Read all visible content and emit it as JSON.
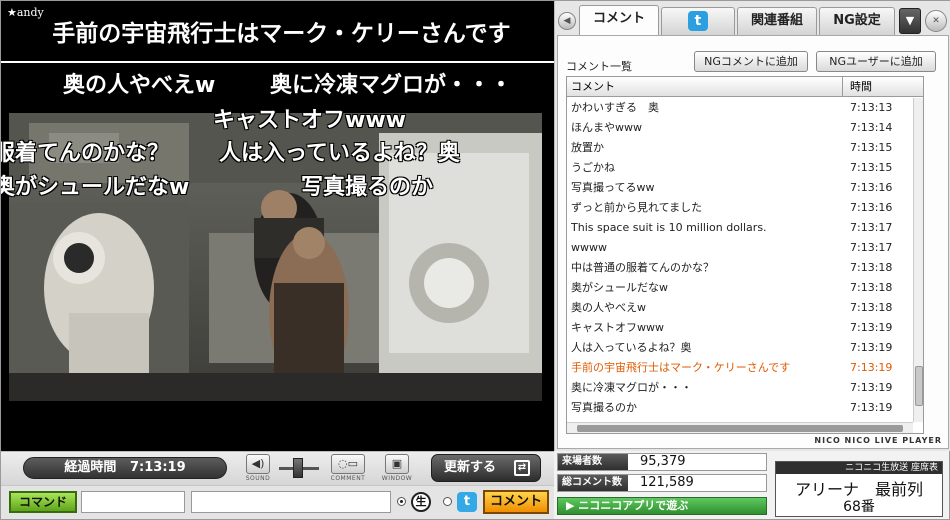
{
  "player": {
    "broadcaster": "andy",
    "telop": "手前の宇宙飛行士はマーク・ケリーさんです",
    "overlay_comments": [
      "奥の人やべえw",
      "奥に冷凍マグロが・・・",
      "キャストオフwww",
      "服着てんのかな？",
      "人は入っているよね？奥",
      "奥がシュールだなw",
      "写真撮るのか"
    ]
  },
  "controls": {
    "elapsed_label": "経過時間",
    "elapsed_time": "7:13:19",
    "sound_label": "SOUND",
    "comment_label": "COMMENT",
    "window_label": "WINDOW",
    "update_label": "更新する"
  },
  "command_bar": {
    "command_button": "コマンド",
    "command_value": "",
    "comment_value": "",
    "live_badge": "生",
    "send_button": "コメント"
  },
  "panel": {
    "tabs": [
      "コメント",
      "関連番組",
      "NG設定"
    ],
    "list_title": "コメント一覧",
    "ng_comment_button": "NGコメントに追加",
    "ng_user_button": "NGユーザーに追加",
    "col_comment": "コメント",
    "col_time": "時間",
    "rows": [
      {
        "comment": "かわいすぎる　奥",
        "time": "7:13:13"
      },
      {
        "comment": "ほんまやwww",
        "time": "7:13:14"
      },
      {
        "comment": "放置か",
        "time": "7:13:15"
      },
      {
        "comment": "うごかね",
        "time": "7:13:15"
      },
      {
        "comment": "写真撮ってるww",
        "time": "7:13:16"
      },
      {
        "comment": "ずっと前から見れてました",
        "time": "7:13:16"
      },
      {
        "comment": "This space suit is 10 million dollars.",
        "time": "7:13:17"
      },
      {
        "comment": "wwww",
        "time": "7:13:17"
      },
      {
        "comment": "中は普通の服着てんのかな？",
        "time": "7:13:18"
      },
      {
        "comment": "奥がシュールだなw",
        "time": "7:13:18"
      },
      {
        "comment": "奥の人やべえw",
        "time": "7:13:18"
      },
      {
        "comment": "キャストオフwww",
        "time": "7:13:19"
      },
      {
        "comment": "人は入っているよね？奥",
        "time": "7:13:19"
      },
      {
        "comment": "手前の宇宙飛行士はマーク・ケリーさんです",
        "time": "7:13:19",
        "highlight": true
      },
      {
        "comment": "奥に冷凍マグロが・・・",
        "time": "7:13:19"
      },
      {
        "comment": "写真撮るのか",
        "time": "7:13:19"
      }
    ],
    "brand": "NICO NICO LIVE PLAYER"
  },
  "stats": {
    "visitors_label": "来場者数",
    "visitors": "95,379",
    "comments_label": "総コメント数",
    "comments": "121,589",
    "app_banner": "ニコニコアプリで遊ぶ"
  },
  "seat": {
    "header": "ニコニコ生放送 座席表",
    "area": "アリーナ　最前列",
    "number": "68番"
  },
  "colors": {
    "highlight_comment": "#e05a00",
    "command_green": "#5ea518",
    "send_orange": "#f08e00",
    "twitter_blue": "#2b9fe0"
  }
}
